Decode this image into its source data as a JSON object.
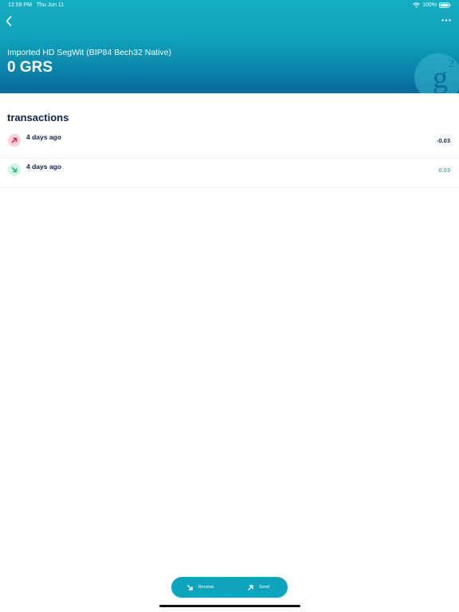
{
  "status_bar": {
    "time": "12:59 PM",
    "date": "Thu Jun 11",
    "battery": "100%"
  },
  "wallet": {
    "label": "Imported HD SegWit (BIP84 Bech32 Native)",
    "balance": "0 GRS",
    "logo_glyph": "g",
    "logo_superscript": "2"
  },
  "transactions": {
    "title": "transactions",
    "items": [
      {
        "direction": "outgoing",
        "date": "4 days ago",
        "amount": "-0.03"
      },
      {
        "direction": "incoming",
        "date": "4 days ago",
        "amount": "0.03"
      }
    ]
  },
  "actions": {
    "receive_label": "Receive",
    "send_label": "Send"
  },
  "icons": [
    "back-icon",
    "more-icon",
    "wifi-icon",
    "battery-icon",
    "arrow-up-right-icon",
    "arrow-down-right-icon",
    "receive-icon",
    "send-icon"
  ],
  "colors": {
    "header_top": "#15adc1",
    "header_bottom": "#06689a",
    "text_dark": "#0c2550",
    "incoming": "#37c0a1",
    "outgoing_icon": "#e0284a",
    "incoming_icon": "#22c37a",
    "pill": "#0fa4bd"
  }
}
